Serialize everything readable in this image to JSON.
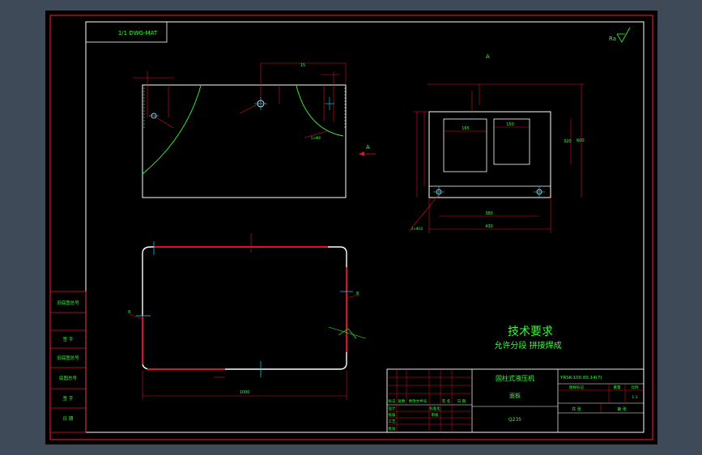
{
  "drawing": {
    "top_left_label": "1/1 DWG-MAT",
    "roughness_note": "Ra",
    "section_label_top": "A",
    "section_arrow_label": "A",
    "dim_top_left_horizontal": "15",
    "dim_ref_hole": "5×M8",
    "dim_top_right_box1": "165",
    "dim_top_right_box2": "150",
    "dim_right_total": "430",
    "dim_right_inner": "380",
    "dim_right_height": "600",
    "dim_right_side": "320",
    "dim_bottom_right_note": "2×Φ10",
    "dim_outline_bottom": "1000",
    "dim_outline_left": "8",
    "dim_outline_right": "8"
  },
  "tech_requirements": {
    "title": "技术要求",
    "line1": "允许分段  拼接焊成"
  },
  "title_block": {
    "product_name": "固柱式液压机",
    "part_name": "面板",
    "material": "Q235",
    "drawing_no": "YRSK-100.00.14(7)",
    "scale_label": "图样标记",
    "weight_label": "重量",
    "ratio_label": "比例",
    "ratio_value": "1:1",
    "sheet_label": "共 张",
    "page_label": "第 张",
    "rev_col1": "标记",
    "rev_col2": "处数",
    "rev_col3": "更改文件号",
    "rev_col4": "签 名",
    "rev_col5": "日 期",
    "designer": "设计",
    "checker": "校核",
    "process": "工艺",
    "standard": "标准化",
    "approve": "审核",
    "date": "批准"
  },
  "left_strip": {
    "item1": "旧底图总号",
    "item2": "签 字",
    "item3": "旧底图总号",
    "item4": "底图总号",
    "item5": "签 字",
    "item6": "日 期"
  }
}
